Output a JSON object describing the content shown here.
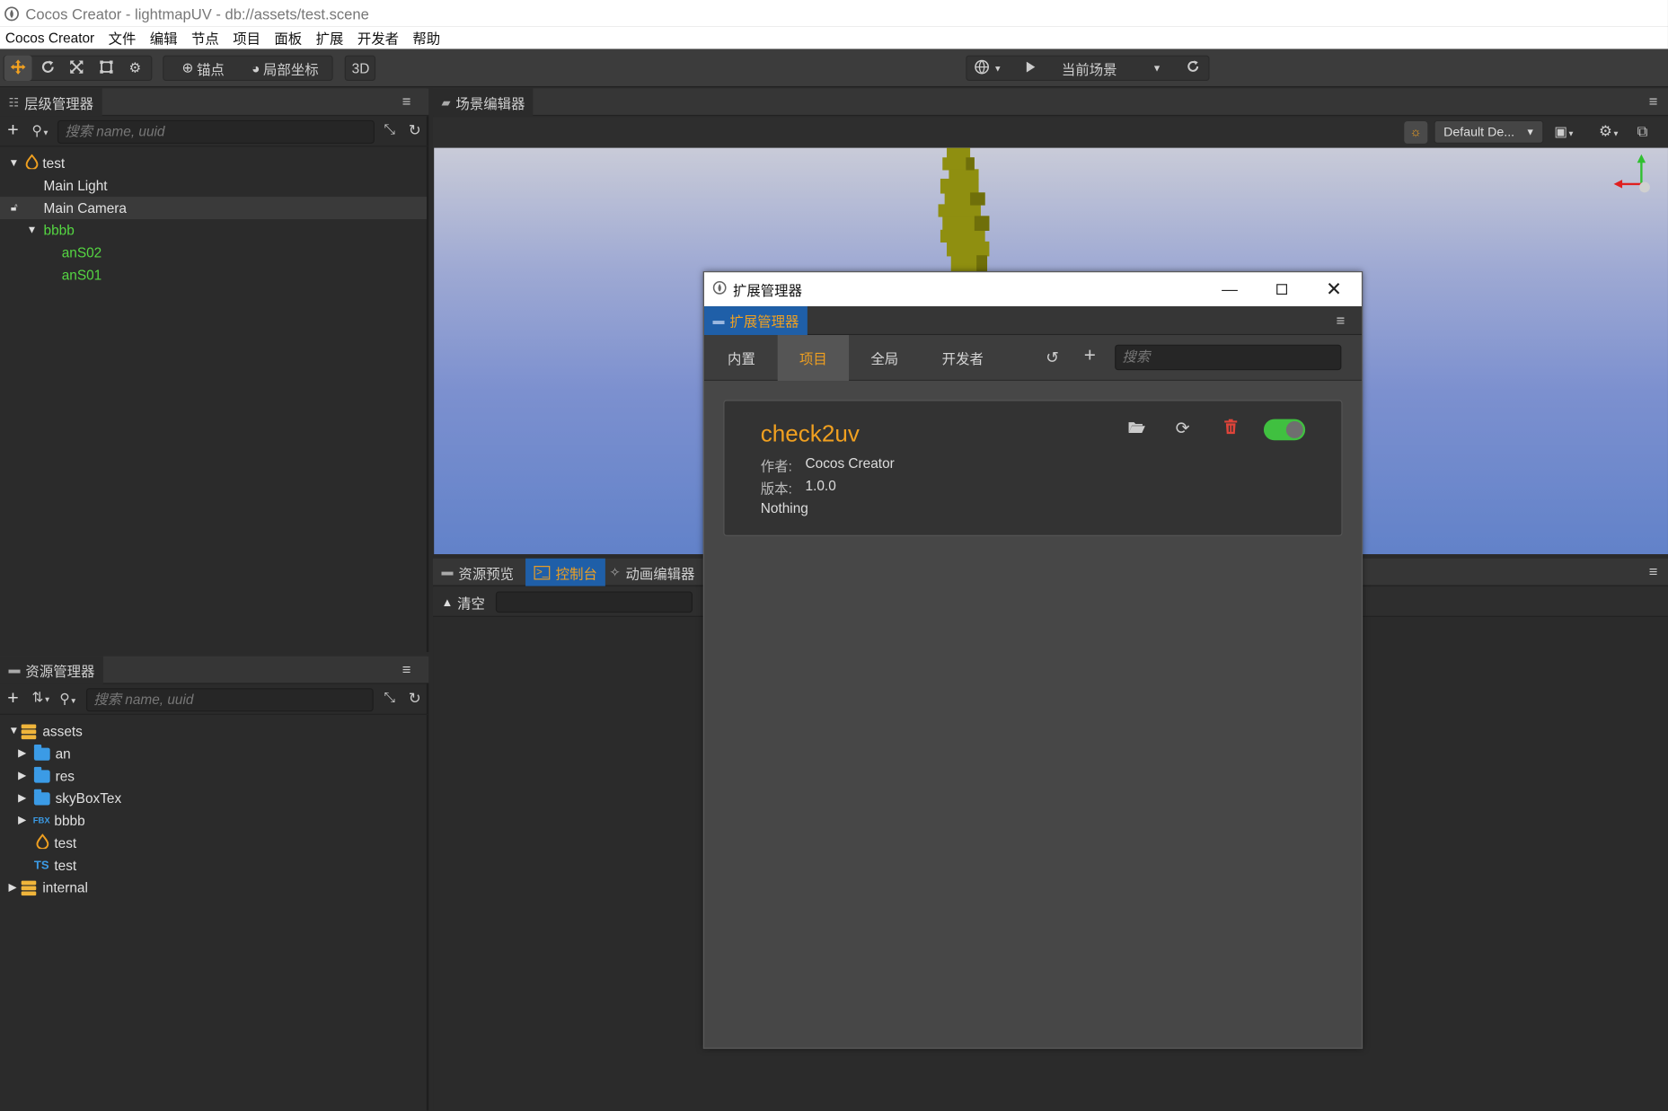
{
  "window": {
    "title": "Cocos Creator - lightmapUV - db://assets/test.scene"
  },
  "menu": [
    "Cocos Creator",
    "文件",
    "编辑",
    "节点",
    "项目",
    "面板",
    "扩展",
    "开发者",
    "帮助"
  ],
  "toolbar": {
    "anchor_label": "锚点",
    "coords_label": "局部坐标",
    "mode_label": "3D",
    "scene_select": "当前场景"
  },
  "hierarchy": {
    "tab_label": "层级管理器",
    "search_placeholder": "搜索 name, uuid",
    "nodes": [
      {
        "label": "test",
        "color": "#e8e8e8"
      },
      {
        "label": "Main Light",
        "color": "#e8e8e8"
      },
      {
        "label": "Main Camera",
        "color": "#e8e8e8"
      },
      {
        "label": "bbbb",
        "color": "#55d642"
      },
      {
        "label": "anS02",
        "color": "#55d642"
      },
      {
        "label": "anS01",
        "color": "#55d642"
      }
    ]
  },
  "assets": {
    "tab_label": "资源管理器",
    "search_placeholder": "搜索 name, uuid",
    "items": [
      {
        "label": "assets",
        "icon": "database-icon"
      },
      {
        "label": "an",
        "icon": "folder-icon"
      },
      {
        "label": "res",
        "icon": "folder-icon"
      },
      {
        "label": "skyBoxTex",
        "icon": "folder-icon"
      },
      {
        "label": "bbbb",
        "icon": "fbx-icon",
        "badge": "FBX"
      },
      {
        "label": "test",
        "icon": "scene-icon"
      },
      {
        "label": "test",
        "icon": "typescript-icon",
        "badge": "TS"
      },
      {
        "label": "internal",
        "icon": "database-icon"
      }
    ]
  },
  "scene_editor": {
    "tab_label": "场景编辑器",
    "camera_select": "Default De..."
  },
  "bottom_panel": {
    "tabs": [
      "资源预览",
      "控制台",
      "动画编辑器"
    ],
    "active_tab": 1,
    "clear_label": "清空"
  },
  "extension_dialog": {
    "title": "扩展管理器",
    "panel_tab": "扩展管理器",
    "tabs": [
      "内置",
      "项目",
      "全局",
      "开发者"
    ],
    "active_tab": 1,
    "search_placeholder": "搜索",
    "extension": {
      "name": "check2uv",
      "author_label": "作者:",
      "author": "Cocos Creator",
      "version_label": "版本:",
      "version": "1.0.0",
      "description": "Nothing",
      "enabled": true
    }
  },
  "colors": {
    "accent_orange": "#f0a020",
    "node_green": "#55d642",
    "selected_blue": "#1f5fa8",
    "toggle_green": "#40c040",
    "delete_red": "#e0443a"
  }
}
